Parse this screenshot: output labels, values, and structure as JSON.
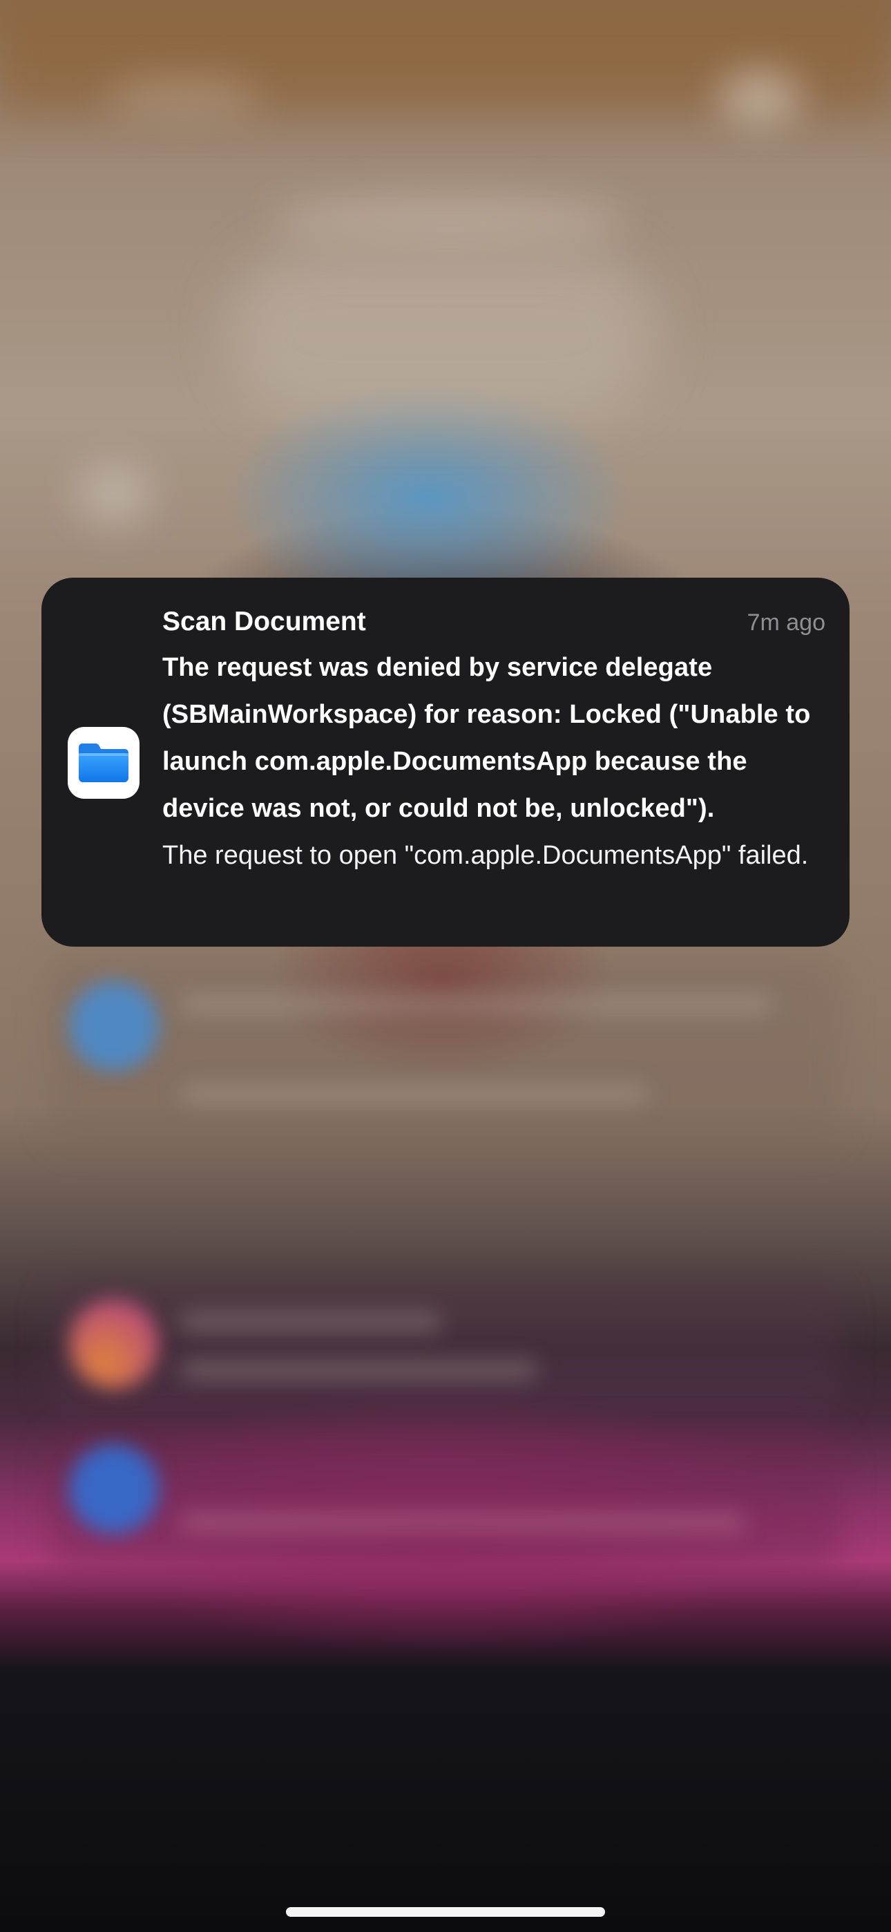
{
  "notification": {
    "app_icon": "files-folder-icon",
    "title": "Scan Document",
    "time": "7m ago",
    "headline": "The request was denied by service delegate (SBMainWorkspace) for reason: Locked (\"Unable to launch com.apple.DocumentsApp because the device was not, or could not be, unlocked\").",
    "body": "The request to open \"com.apple.DocumentsApp\" failed."
  },
  "colors": {
    "card_background": "#1c1c1e",
    "title_text": "#ffffff",
    "time_text": "#8e8e93",
    "folder_blue": "#1a8cff"
  }
}
